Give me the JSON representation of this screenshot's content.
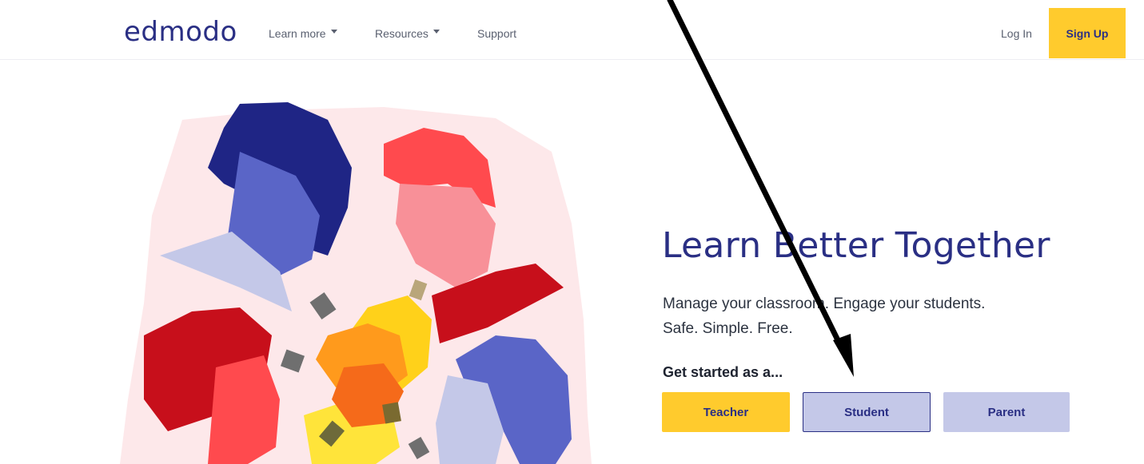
{
  "nav": {
    "logo": "edmodo",
    "items": [
      {
        "label": "Learn more",
        "dropdown": true
      },
      {
        "label": "Resources",
        "dropdown": true
      },
      {
        "label": "Support",
        "dropdown": false
      }
    ],
    "login": "Log In",
    "signup": "Sign Up"
  },
  "hero": {
    "headline": "Learn Better Together",
    "subline1": "Manage your classroom. Engage your students.",
    "subline2": "Safe. Simple. Free.",
    "get_started": "Get started as a...",
    "roles": {
      "teacher": "Teacher",
      "student": "Student",
      "parent": "Parent"
    }
  },
  "colors": {
    "brand_navy": "#2a2f84",
    "accent_yellow": "#ffcb2d",
    "lavender": "#c4c8e8",
    "coral": "#ff4a4e",
    "blue_violet": "#5a65c7",
    "dark_red": "#c70f1b"
  }
}
